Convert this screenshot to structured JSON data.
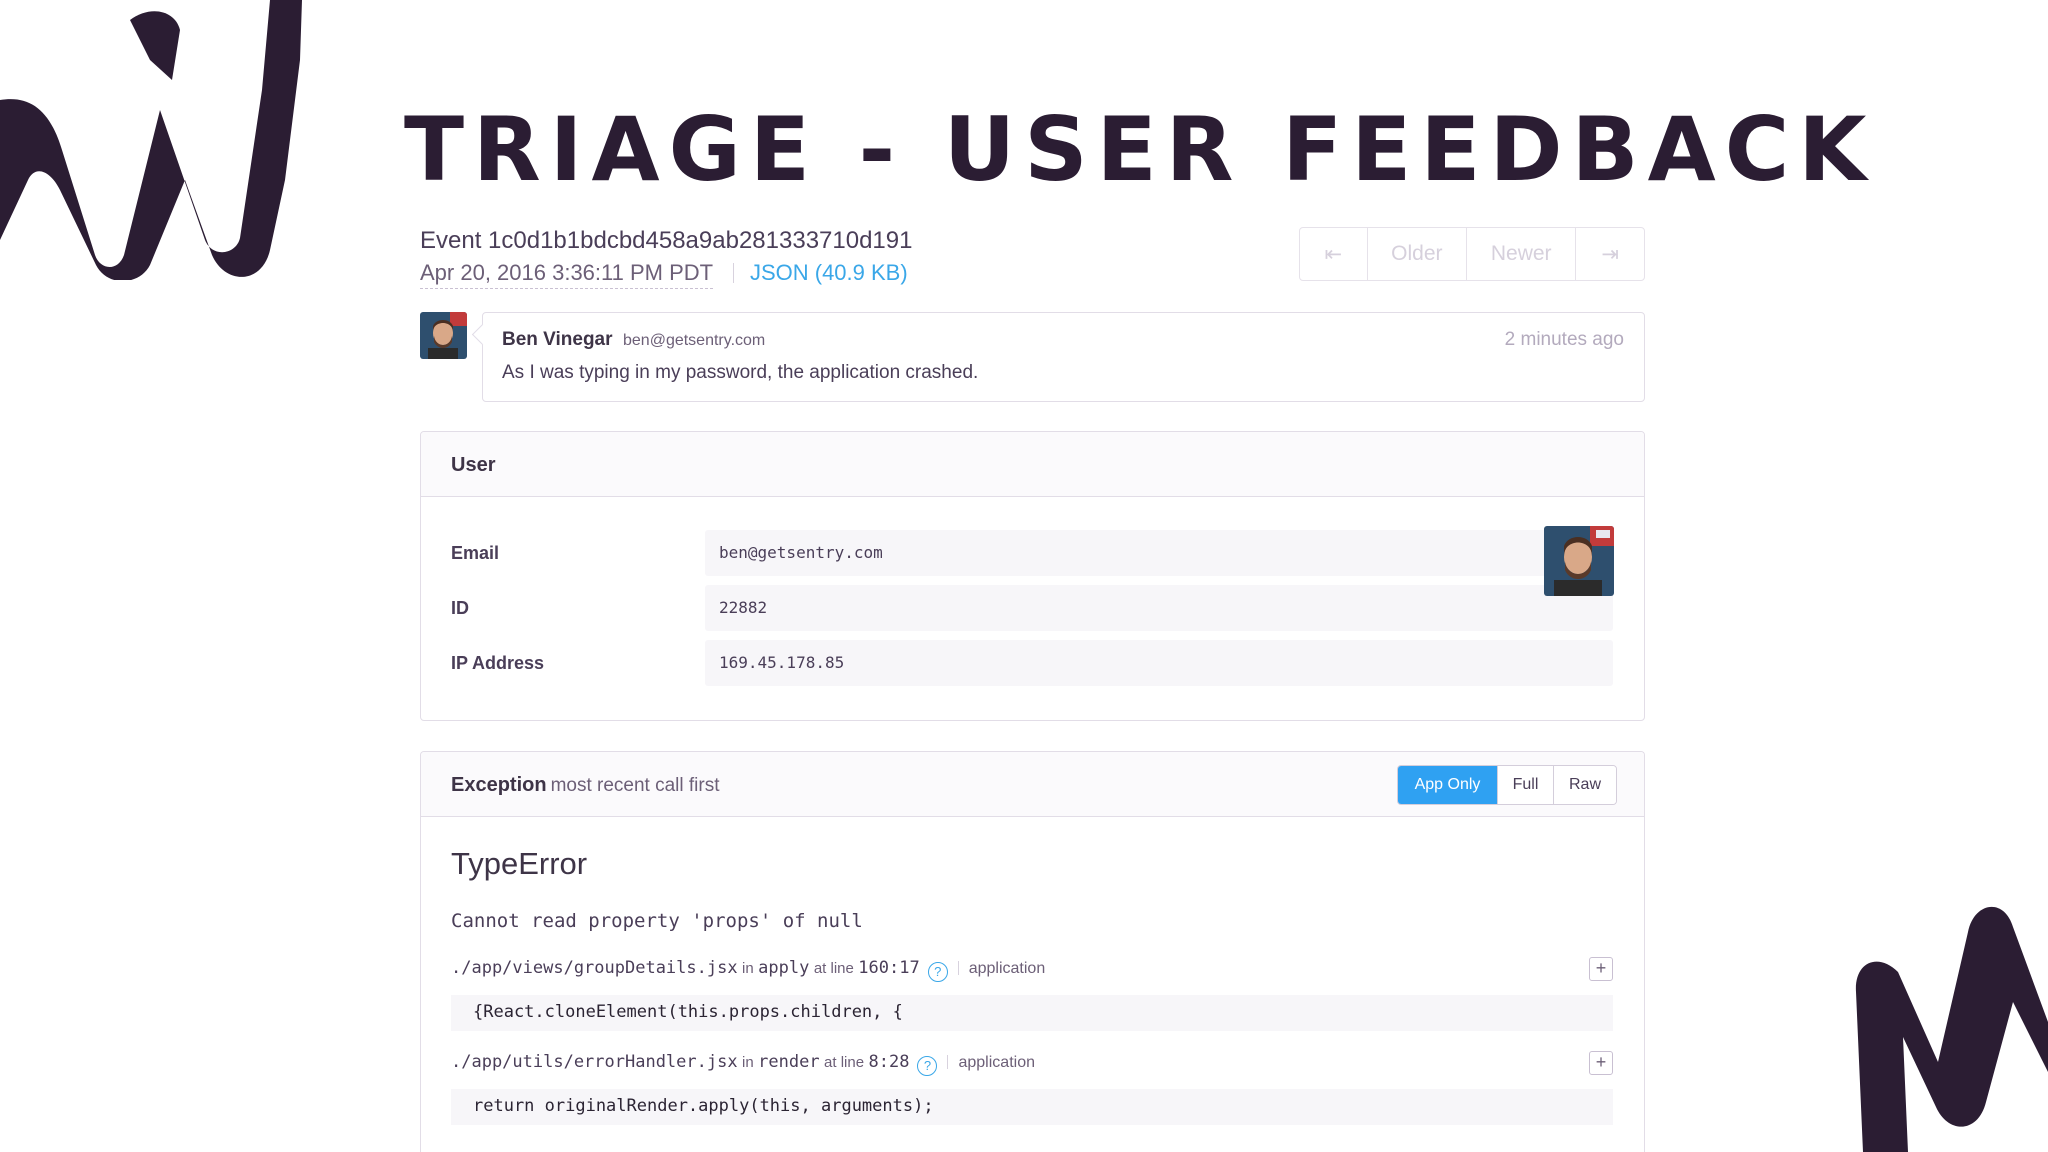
{
  "slide": {
    "title": "TRIAGE - USER FEEDBACK"
  },
  "event": {
    "id_label": "Event 1c0d1b1bdcbd458a9ab281333710d191",
    "date": "Apr 20, 2016 3:36:11 PM PDT",
    "json_link": "JSON (40.9 KB)"
  },
  "pager": {
    "first": "⇤",
    "older": "Older",
    "newer": "Newer",
    "last": "⇥"
  },
  "comment": {
    "author": "Ben Vinegar",
    "email": "ben@getsentry.com",
    "time": "2 minutes ago",
    "text": "As I was typing in my password, the application crashed."
  },
  "user_panel": {
    "title": "User",
    "rows": [
      {
        "key": "Email",
        "value": "ben@getsentry.com"
      },
      {
        "key": "ID",
        "value": "22882"
      },
      {
        "key": "IP Address",
        "value": "169.45.178.85"
      }
    ]
  },
  "exception": {
    "title": "Exception",
    "subtitle": "most recent call first",
    "buttons": {
      "app_only": "App Only",
      "full": "Full",
      "raw": "Raw"
    },
    "type": "TypeError",
    "message": "Cannot read property 'props' of null",
    "frames": [
      {
        "file": "./app/views/groupDetails.jsx",
        "in_word": "in",
        "function": "apply",
        "at_line_word": "at line",
        "line": "160:17",
        "help": "?",
        "context": "application",
        "code": "{React.cloneElement(this.props.children, {",
        "expand": "+"
      },
      {
        "file": "./app/utils/errorHandler.jsx",
        "in_word": "in",
        "function": "render",
        "at_line_word": "at line",
        "line": "8:28",
        "help": "?",
        "context": "application",
        "code": "return originalRender.apply(this, arguments);",
        "expand": "+"
      }
    ]
  },
  "colors": {
    "accent": "#2fa1f2",
    "link": "#3aa7e8",
    "decor": "#2b1d33"
  }
}
